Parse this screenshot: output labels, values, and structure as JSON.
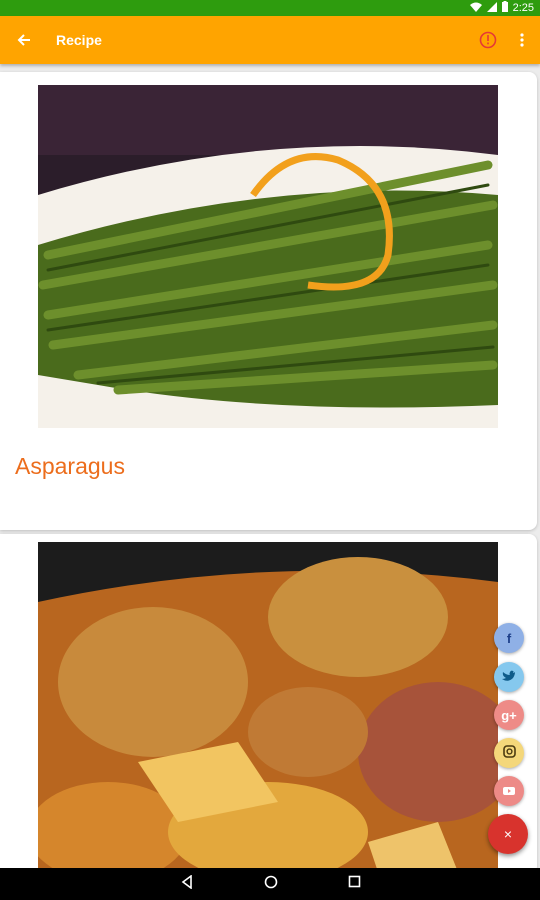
{
  "status_bar": {
    "time": "2:25",
    "icons": [
      "wifi-icon",
      "signal-icon",
      "battery-icon"
    ]
  },
  "app_bar": {
    "title": "Recipe",
    "icons": [
      "back-arrow-icon",
      "info-icon",
      "more-vert-icon"
    ],
    "color": "#ffa400"
  },
  "recipes": [
    {
      "title": "Asparagus",
      "image": "asparagus-photo"
    },
    {
      "title": "",
      "image": "meatball-stew-photo"
    }
  ],
  "share": {
    "items": [
      {
        "name": "facebook",
        "glyph": "f"
      },
      {
        "name": "twitter",
        "glyph": "t"
      },
      {
        "name": "google-plus",
        "glyph": "g+"
      },
      {
        "name": "instagram",
        "glyph": ""
      },
      {
        "name": "youtube",
        "glyph": ""
      }
    ],
    "close_glyph": "×",
    "close_color": "#d8332d"
  },
  "nav_bar": {
    "icons": [
      "back-triangle-icon",
      "home-circle-icon",
      "recents-square-icon"
    ]
  },
  "colors": {
    "status_bar": "#2e9c0e",
    "title_text": "#ec6d1c"
  }
}
